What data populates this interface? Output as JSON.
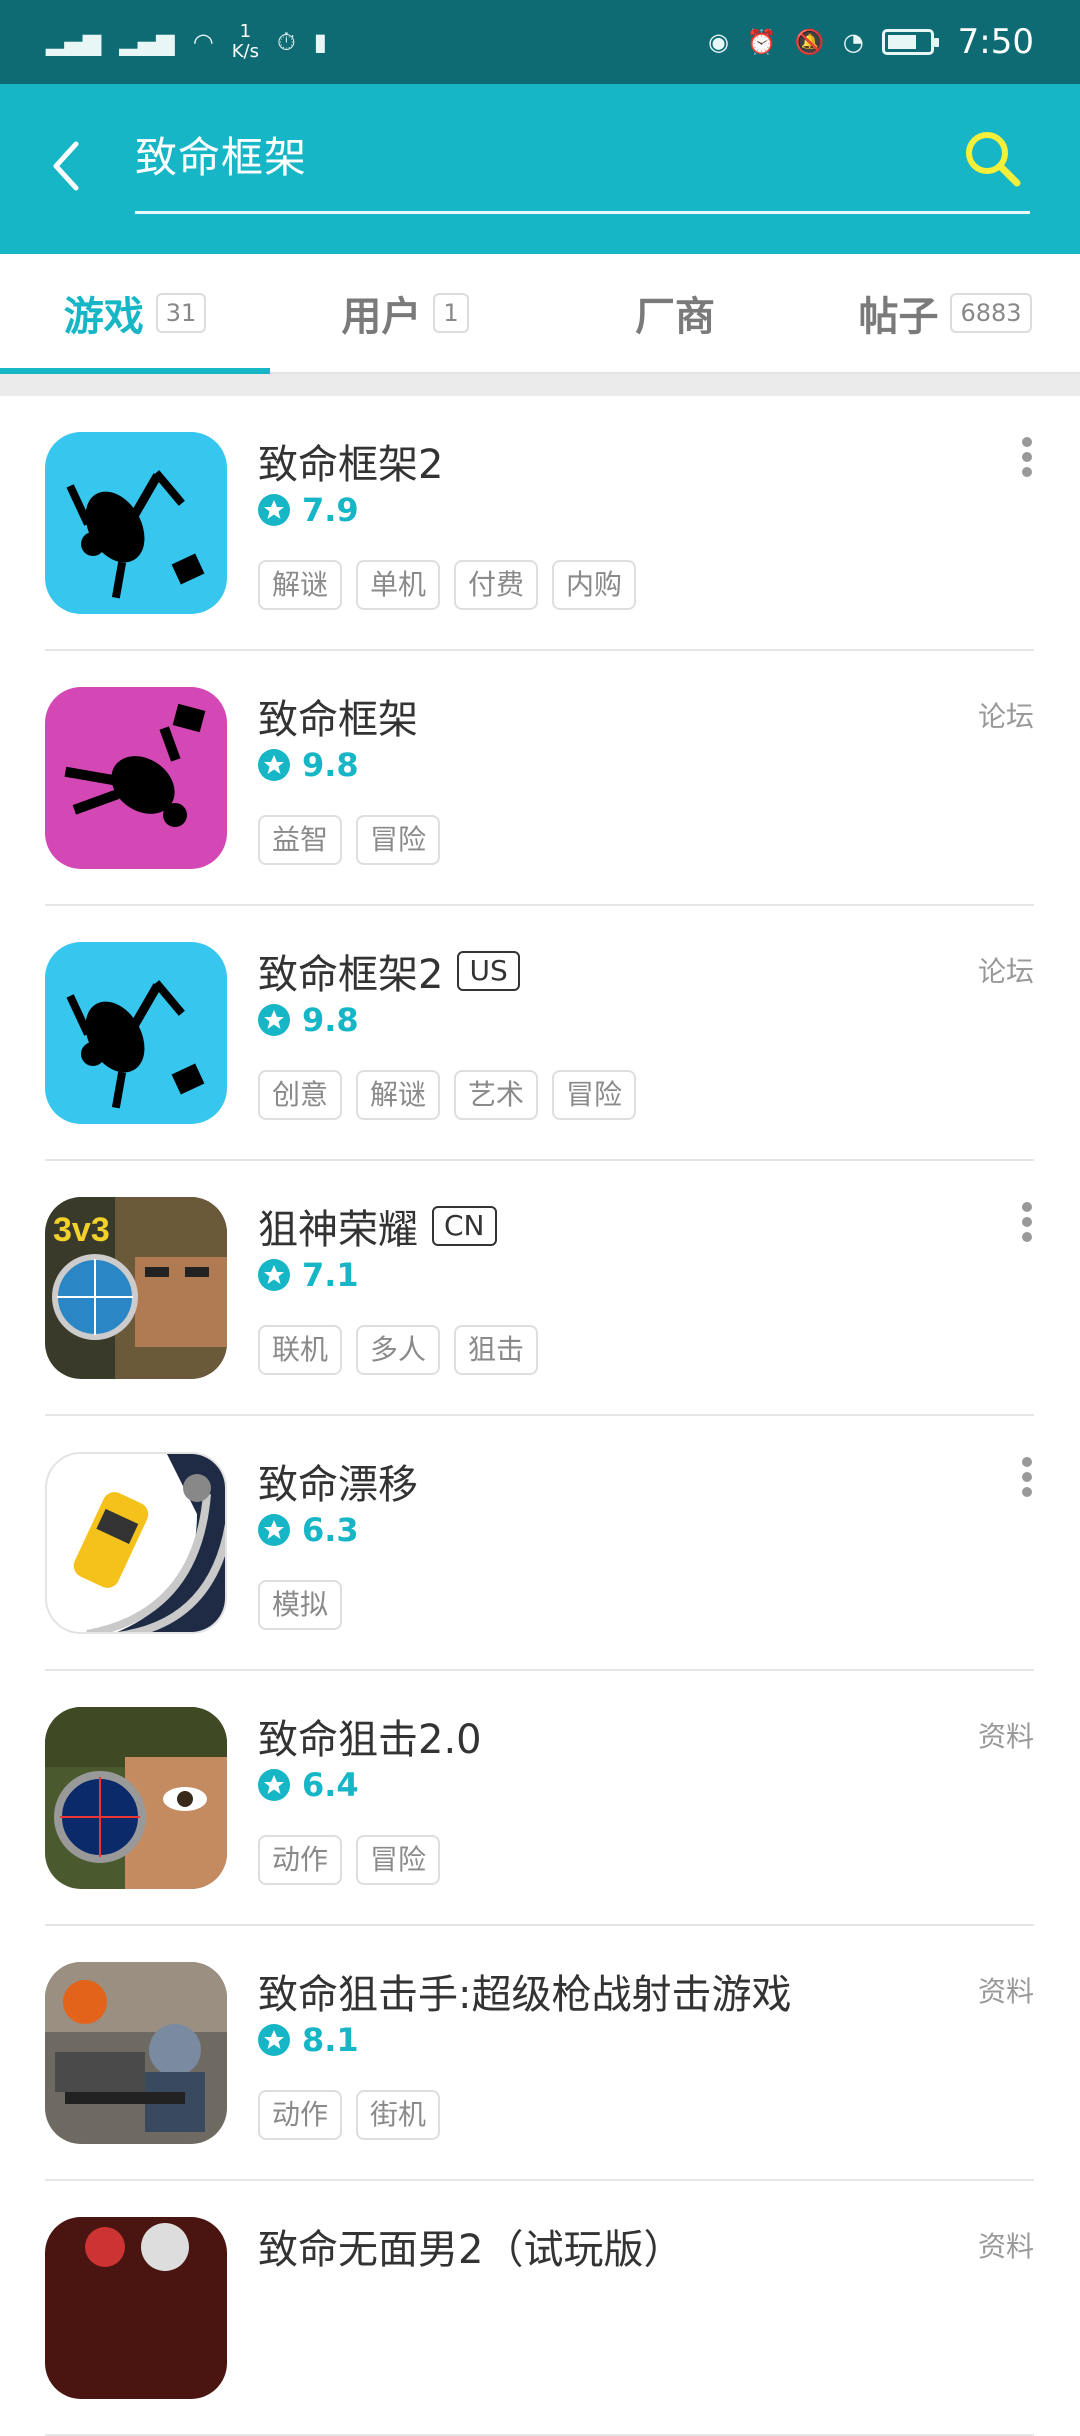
{
  "status_bar": {
    "signal_left": "46",
    "net_speed_num": "1",
    "net_speed_unit": "K/s",
    "time": "7:50"
  },
  "search": {
    "query": "致命框架"
  },
  "tabs": [
    {
      "label": "游戏",
      "count": "31",
      "active": true
    },
    {
      "label": "用户",
      "count": "1"
    },
    {
      "label": "厂商",
      "count": ""
    },
    {
      "label": "帖子",
      "count": "6883"
    }
  ],
  "results": [
    {
      "name": "致命框架2",
      "badge": "",
      "rating": "7.9",
      "tags": [
        "解谜",
        "单机",
        "付费",
        "内购"
      ],
      "side": "",
      "action": "more"
    },
    {
      "name": "致命框架",
      "badge": "",
      "rating": "9.8",
      "tags": [
        "益智",
        "冒险"
      ],
      "side": "论坛",
      "action": "link"
    },
    {
      "name": "致命框架2",
      "badge": "US",
      "rating": "9.8",
      "tags": [
        "创意",
        "解谜",
        "艺术",
        "冒险"
      ],
      "side": "论坛",
      "action": "link"
    },
    {
      "name": "狙神荣耀",
      "badge": "CN",
      "rating": "7.1",
      "tags": [
        "联机",
        "多人",
        "狙击"
      ],
      "side": "",
      "action": "more"
    },
    {
      "name": "致命漂移",
      "badge": "",
      "rating": "6.3",
      "tags": [
        "模拟"
      ],
      "side": "",
      "action": "more"
    },
    {
      "name": "致命狙击2.0",
      "badge": "",
      "rating": "6.4",
      "tags": [
        "动作",
        "冒险"
      ],
      "side": "资料",
      "action": "link"
    },
    {
      "name": "致命狙击手:超级枪战射击游戏",
      "badge": "",
      "rating": "8.1",
      "tags": [
        "动作",
        "街机"
      ],
      "side": "资料",
      "action": "link"
    },
    {
      "name": "致命无面男2（试玩版）",
      "badge": "",
      "rating": "",
      "tags": [],
      "side": "资料",
      "action": "link"
    }
  ],
  "colors": {
    "status_bar": "#0e6b73",
    "accent": "#17b6c6",
    "search_icon": "#f4ef3a"
  }
}
